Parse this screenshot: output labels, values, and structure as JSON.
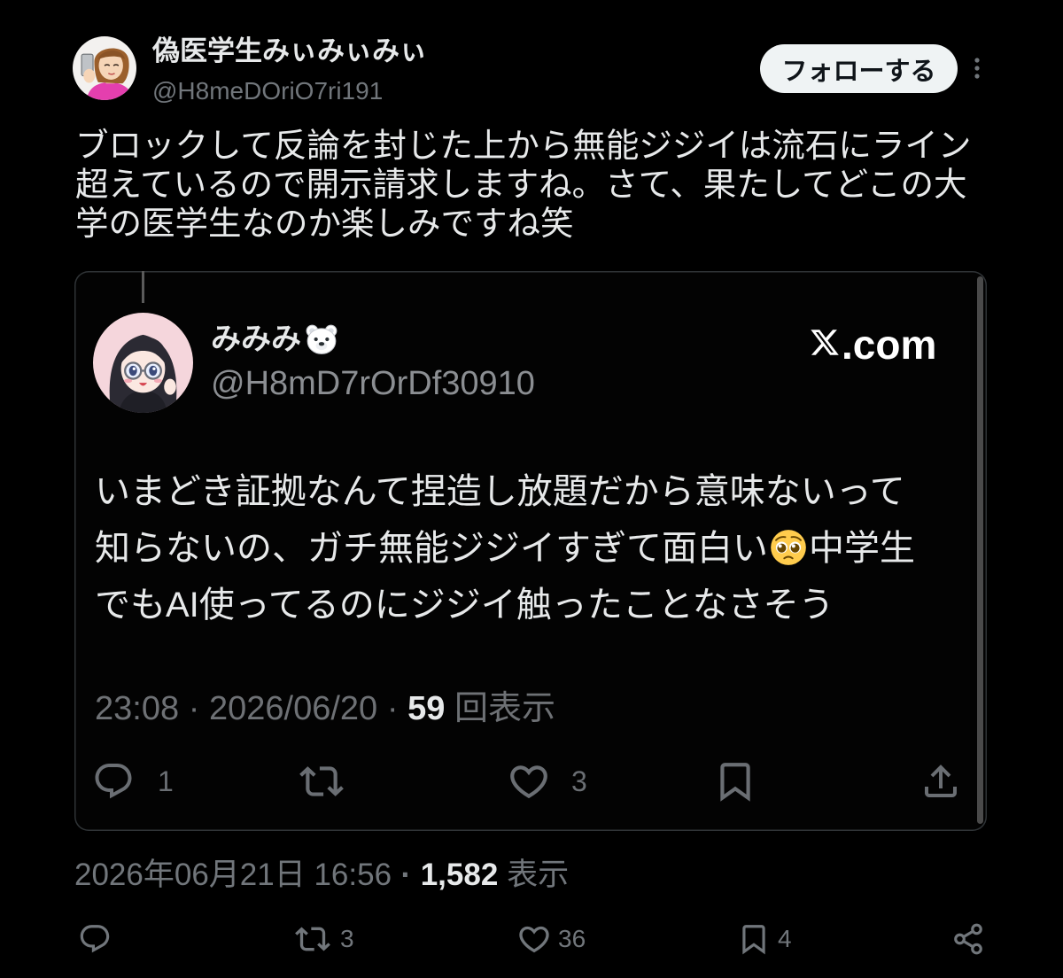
{
  "author": {
    "display_name": "偽医学生みぃみぃみぃ",
    "handle": "@H8meDOriO7ri191",
    "avatar": "user-avatar"
  },
  "follow_button": {
    "label": "フォローする"
  },
  "more_menu": {
    "icon": "more-vertical-icon"
  },
  "tweet": {
    "text_lines": [
      "ブロックして反論を封じた上から無能ジジイは流石にライン",
      "超えているので開示請求しますね。さて、果たしてどこの大",
      "学の医学生なのか楽しみですね笑"
    ]
  },
  "quoted": {
    "display_name": "みみみ",
    "name_emoji": "polar-bear-emoji",
    "handle": "@H8mD7rOrDf30910",
    "source_logo": "x-logo-icon",
    "source_suffix": ".com",
    "body": {
      "line1": "いまどき証拠なんて捏造し放題だから意味ないって",
      "line2_before": "知らないの、ガチ無能ジジイすぎて面白い",
      "line2_emoji": "pleading-face-emoji",
      "line2_after": "中学生",
      "line3": "でもAI使ってるのにジジイ触ったことなさそう"
    },
    "meta": {
      "time": "23:08",
      "separator": "·",
      "date": "2026/06/20",
      "views_count": "59",
      "views_label": "回表示"
    },
    "actions": {
      "reply_count": "1",
      "like_count": "3",
      "icons": [
        "reply-icon",
        "retweet-icon",
        "heart-icon",
        "bookmark-icon",
        "share-icon"
      ]
    }
  },
  "footer_meta": {
    "timestamp": "2026年06月21日 16:56",
    "separator": "·",
    "views_count": "1,582",
    "views_label": "表示"
  },
  "actions": {
    "retweet_count": "3",
    "like_count": "36",
    "bookmark_count": "4",
    "icons": [
      "reply-icon",
      "retweet-icon",
      "heart-icon",
      "bookmark-icon",
      "share-icon"
    ]
  },
  "colors": {
    "background": "#000000",
    "text": "#e7e9ea",
    "muted": "#71767b",
    "border": "#2f3336",
    "follow_bg": "#eff3f4",
    "follow_text": "#0f1419"
  }
}
